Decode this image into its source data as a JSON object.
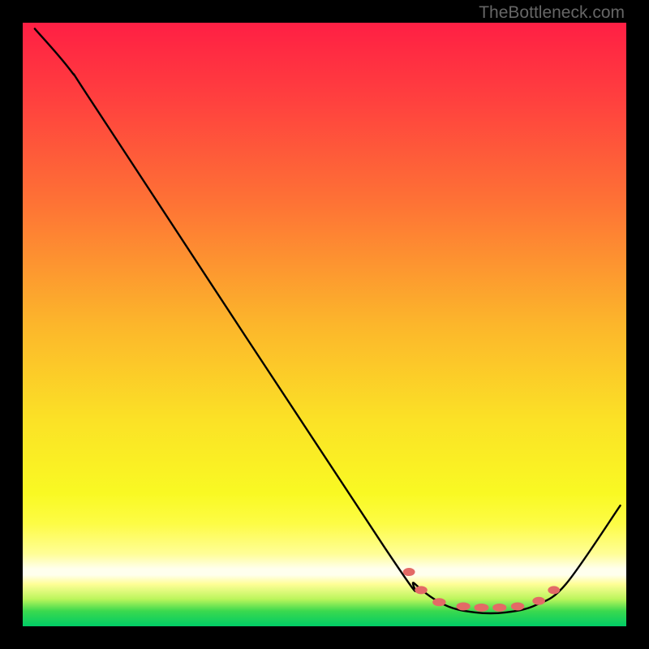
{
  "watermark": "TheBottleneck.com",
  "chart_data": {
    "type": "line",
    "title": "",
    "xlabel": "",
    "ylabel": "",
    "xlim": [
      0,
      100
    ],
    "ylim": [
      0,
      100
    ],
    "grid": false,
    "legend": false,
    "series": [
      {
        "name": "curve",
        "color": "#000000",
        "points": [
          {
            "x": 2,
            "y": 99
          },
          {
            "x": 8,
            "y": 92
          },
          {
            "x": 14,
            "y": 83
          },
          {
            "x": 60,
            "y": 13
          },
          {
            "x": 65,
            "y": 7
          },
          {
            "x": 70,
            "y": 3.5
          },
          {
            "x": 75,
            "y": 2.3
          },
          {
            "x": 80,
            "y": 2.3
          },
          {
            "x": 85,
            "y": 3.5
          },
          {
            "x": 90,
            "y": 7
          },
          {
            "x": 99,
            "y": 20
          }
        ]
      }
    ],
    "dashed_markers": {
      "color": "#E36A66",
      "points": [
        {
          "x": 64,
          "y": 9
        },
        {
          "x": 66,
          "y": 6
        },
        {
          "x": 69,
          "y": 4
        },
        {
          "x": 73,
          "y": 3.3
        },
        {
          "x": 76,
          "y": 3.1
        },
        {
          "x": 79,
          "y": 3.1
        },
        {
          "x": 82,
          "y": 3.3
        },
        {
          "x": 85.5,
          "y": 4.2
        },
        {
          "x": 88,
          "y": 6
        }
      ]
    },
    "gradient": {
      "stops": [
        {
          "offset": 0.0,
          "color": "#FF1F44"
        },
        {
          "offset": 0.12,
          "color": "#FF3E3F"
        },
        {
          "offset": 0.3,
          "color": "#FE7335"
        },
        {
          "offset": 0.5,
          "color": "#FCB62B"
        },
        {
          "offset": 0.66,
          "color": "#FBE226"
        },
        {
          "offset": 0.78,
          "color": "#F9F923"
        },
        {
          "offset": 0.83,
          "color": "#FDFC45"
        },
        {
          "offset": 0.88,
          "color": "#FFFE97"
        },
        {
          "offset": 0.905,
          "color": "#FFFFEE"
        },
        {
          "offset": 0.915,
          "color": "#FFFFEE"
        },
        {
          "offset": 0.93,
          "color": "#FFFE97"
        },
        {
          "offset": 0.955,
          "color": "#BBF55C"
        },
        {
          "offset": 0.975,
          "color": "#3AD94E"
        },
        {
          "offset": 1.0,
          "color": "#00CC66"
        }
      ]
    }
  }
}
